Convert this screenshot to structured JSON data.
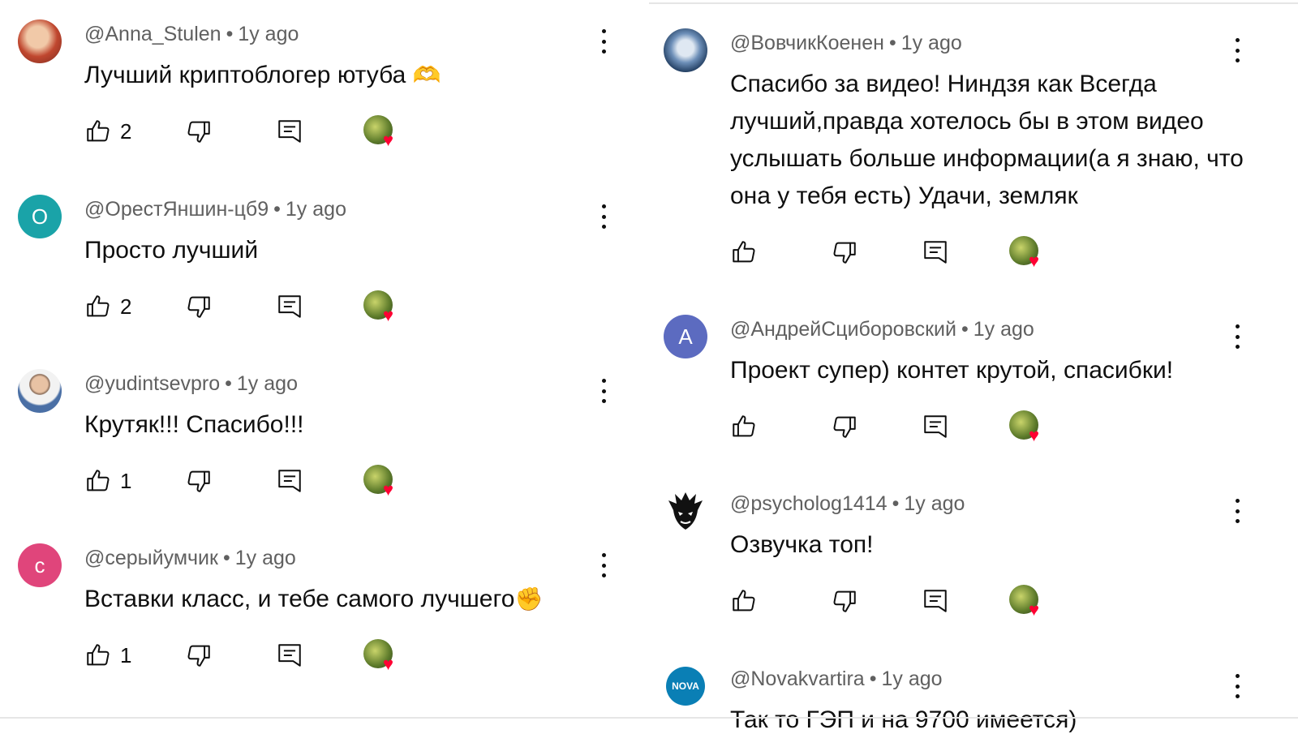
{
  "left_comments": [
    {
      "author": "@Anna_Stulen",
      "time": "1y ago",
      "text": "Лучший криптоблогер ютуба",
      "emoji": "🫶",
      "likes": "2",
      "avatar_letter": "",
      "avatar_color": "#b04a3a"
    },
    {
      "author": "@ОрестЯншин-цб9",
      "time": "1y ago",
      "text": "Просто лучший",
      "emoji": "",
      "likes": "2",
      "avatar_letter": "О",
      "avatar_color": "#1aa3a8"
    },
    {
      "author": "@yudintsevpro",
      "time": "1y ago",
      "text": "Крутяк!!! Спасибо!!!",
      "emoji": "",
      "likes": "1",
      "avatar_letter": "",
      "avatar_color": "#c7b49a"
    },
    {
      "author": "@серыйумчик",
      "time": "1y ago",
      "text": "Вставки класс, и тебе самого лучшего",
      "emoji": "✊",
      "likes": "1",
      "avatar_letter": "с",
      "avatar_color": "#e0457b"
    }
  ],
  "right_comments": [
    {
      "author": "@ВовчикКоенен",
      "time": "1y ago",
      "text": "Спасибо за видео! Ниндзя как Всегда лучший,правда хотелось бы в этом видео услышать больше информации(а я знаю, что она у тебя есть) Удачи, земляк",
      "likes": "",
      "avatar_letter": "",
      "avatar_color": "#3a5f8f"
    },
    {
      "author": "@АндрейСциборовский",
      "time": "1y ago",
      "text": "Проект супер) контет крутой, спасибки!",
      "likes": "",
      "avatar_letter": "А",
      "avatar_color": "#5c6bc0"
    },
    {
      "author": "@psycholog1414",
      "time": "1y ago",
      "text": "Озвучка топ!",
      "likes": "",
      "avatar_letter": "",
      "avatar_color": "#ffffff"
    },
    {
      "author": "@Novakvartira",
      "time": "1y ago",
      "text": "Так то ГЭП и на 9700 имеется)",
      "likes": "",
      "avatar_letter": "NOVA",
      "avatar_color": "#0a7fb5"
    }
  ],
  "separator": "•",
  "colors": {
    "heart": "#ff0033",
    "meta": "#606060",
    "text": "#0f0f0f"
  }
}
